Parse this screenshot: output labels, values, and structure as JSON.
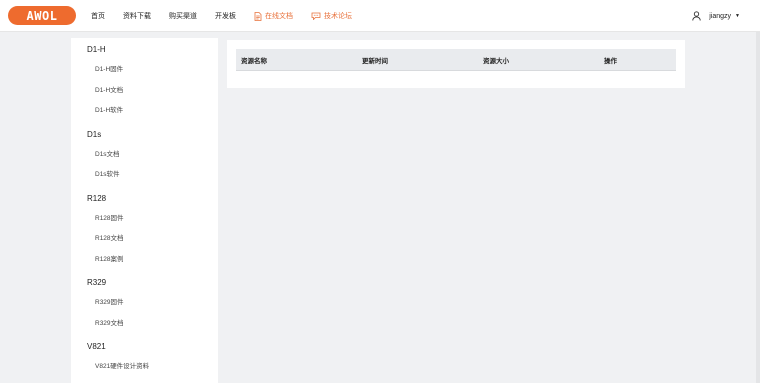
{
  "header": {
    "logo_text": "AWOL",
    "nav": [
      {
        "label": "首页"
      },
      {
        "label": "资料下载"
      },
      {
        "label": "购买渠道"
      },
      {
        "label": "开发板"
      },
      {
        "label": "在线文档",
        "icon": "document-icon"
      },
      {
        "label": "技术论坛",
        "icon": "forum-icon"
      }
    ],
    "accent_color": "#e8703a",
    "user": {
      "name": "jiangzy",
      "icon": "user-icon"
    }
  },
  "sidebar": {
    "groups": [
      {
        "title": "D1-H",
        "items": [
          "D1-H固件",
          "D1-H文档",
          "D1-H软件"
        ]
      },
      {
        "title": "D1s",
        "items": [
          "D1s文档",
          "D1s软件"
        ]
      },
      {
        "title": "R128",
        "items": [
          "R128固件",
          "R128文档",
          "R128案例"
        ]
      },
      {
        "title": "R329",
        "items": [
          "R329固件",
          "R329文档"
        ]
      },
      {
        "title": "V821",
        "items": [
          "V821硬件设计资料"
        ]
      }
    ]
  },
  "table": {
    "columns": [
      "资源名称",
      "更新时间",
      "资源大小",
      "操作"
    ],
    "rows": []
  }
}
